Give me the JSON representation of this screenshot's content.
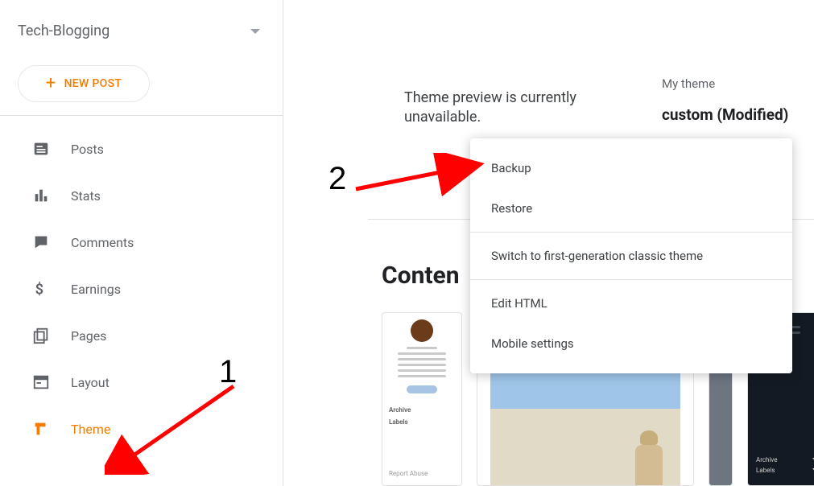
{
  "sidebar": {
    "blog_name": "Tech-Blogging",
    "new_post_label": "NEW POST",
    "items": [
      {
        "id": "posts",
        "label": "Posts",
        "active": false
      },
      {
        "id": "stats",
        "label": "Stats",
        "active": false
      },
      {
        "id": "comments",
        "label": "Comments",
        "active": false
      },
      {
        "id": "earnings",
        "label": "Earnings",
        "active": false
      },
      {
        "id": "pages",
        "label": "Pages",
        "active": false
      },
      {
        "id": "layout",
        "label": "Layout",
        "active": false
      },
      {
        "id": "theme",
        "label": "Theme",
        "active": true
      }
    ]
  },
  "main": {
    "preview_unavailable": "Theme preview is currently unavailable.",
    "my_theme_label": "My theme",
    "my_theme_value": "custom (Modified)",
    "content_section_visible": "Conten"
  },
  "menu": {
    "backup": "Backup",
    "restore": "Restore",
    "switch_classic": "Switch to first-generation classic theme",
    "edit_html": "Edit HTML",
    "mobile_settings": "Mobile settings"
  },
  "previews": {
    "card1": {
      "archive_label": "Archive",
      "labels_label": "Labels",
      "report_label": "Report Abuse"
    },
    "card4": {
      "archive_label": "Archive",
      "labels_label": "Labels"
    }
  },
  "annotations": {
    "num1": "1",
    "num2": "2"
  }
}
